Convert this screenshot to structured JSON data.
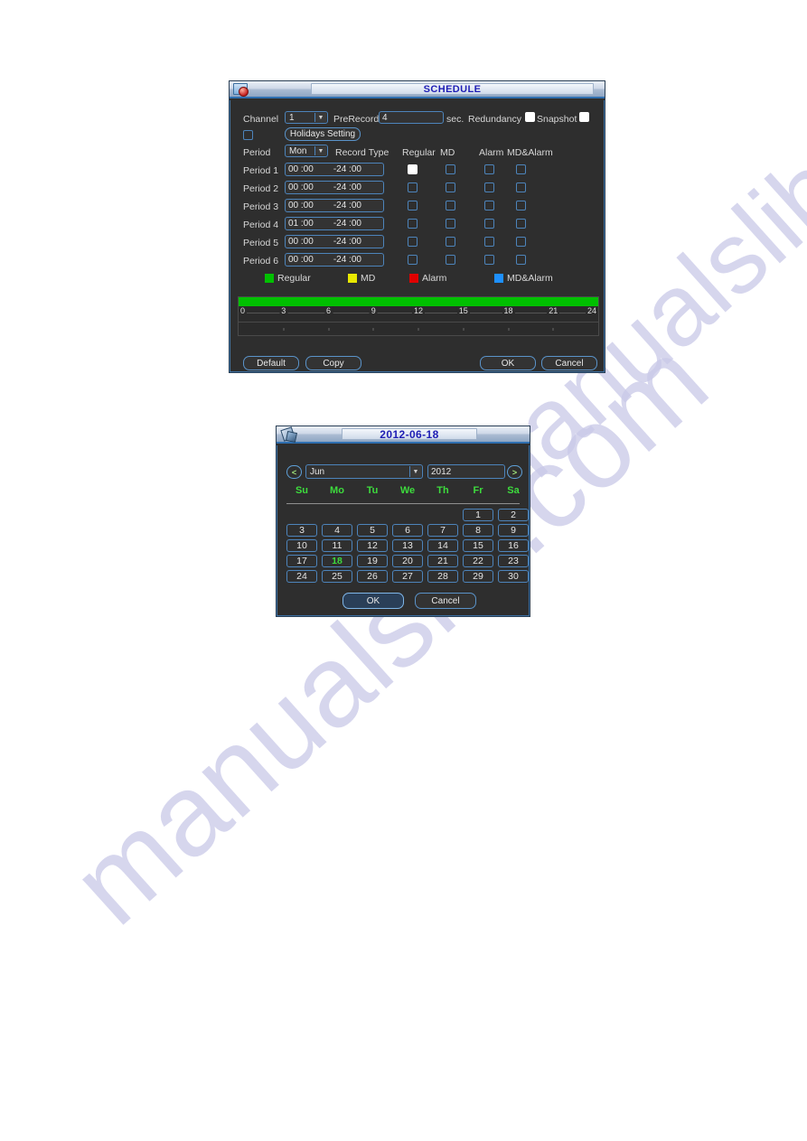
{
  "page": {
    "background": "#ffffff",
    "watermark_text": "manualslib.com",
    "watermark_color": "#c9c9e8"
  },
  "schedule_dialog": {
    "title": "SCHEDULE",
    "title_icon": "folder-clock-icon",
    "channel_label": "Channel",
    "channel_value": "1",
    "prerecord_label": "PreRecord",
    "prerecord_value": "4",
    "sec_label": "sec.",
    "redundancy_label": "Redundancy",
    "redundancy_checked": true,
    "snapshot_label": "Snapshot",
    "snapshot_checked": true,
    "holiday_checkbox_checked": false,
    "holidays_setting_label": "Holidays Setting",
    "period_label": "Period",
    "weekday_value": "Mon",
    "record_type_label": "Record Type",
    "record_type_columns": [
      "Regular",
      "MD",
      "Alarm",
      "MD&Alarm"
    ],
    "periods": [
      {
        "label": "Period 1",
        "start": "00 :00",
        "end": "-24 :00",
        "regular": true,
        "md": false,
        "alarm": false,
        "md_alarm": false
      },
      {
        "label": "Period 2",
        "start": "00 :00",
        "end": "-24 :00",
        "regular": false,
        "md": false,
        "alarm": false,
        "md_alarm": false
      },
      {
        "label": "Period 3",
        "start": "00 :00",
        "end": "-24 :00",
        "regular": false,
        "md": false,
        "alarm": false,
        "md_alarm": false
      },
      {
        "label": "Period 4",
        "start": "01 :00",
        "end": "-24 :00",
        "regular": false,
        "md": false,
        "alarm": false,
        "md_alarm": false
      },
      {
        "label": "Period 5",
        "start": "00 :00",
        "end": "-24 :00",
        "regular": false,
        "md": false,
        "alarm": false,
        "md_alarm": false
      },
      {
        "label": "Period 6",
        "start": "00 :00",
        "end": "-24 :00",
        "regular": false,
        "md": false,
        "alarm": false,
        "md_alarm": false
      }
    ],
    "legend": [
      {
        "label": "Regular",
        "color": "#00c000"
      },
      {
        "label": "MD",
        "color": "#e8e800"
      },
      {
        "label": "Alarm",
        "color": "#e00000"
      },
      {
        "label": "MD&Alarm",
        "color": "#1e90ff"
      }
    ],
    "timeline": {
      "fill_color": "#00c000",
      "fill_from_hour": 0,
      "fill_to_hour": 24,
      "hour_ticks": [
        "0",
        "3",
        "6",
        "9",
        "12",
        "15",
        "18",
        "21",
        "24"
      ]
    },
    "buttons": {
      "default_label": "Default",
      "copy_label": "Copy",
      "ok_label": "OK",
      "cancel_label": "Cancel"
    }
  },
  "calendar_dialog": {
    "title": "2012-06-18",
    "title_icon": "calendar-icon",
    "prev_label": "<",
    "next_label": ">",
    "month_value": "Jun",
    "year_value": "2012",
    "day_headers": [
      "Su",
      "Mo",
      "Tu",
      "We",
      "Th",
      "Fr",
      "Sa"
    ],
    "weeks": [
      [
        "",
        "",
        "",
        "",
        "",
        "1",
        "2"
      ],
      [
        "3",
        "4",
        "5",
        "6",
        "7",
        "8",
        "9"
      ],
      [
        "10",
        "11",
        "12",
        "13",
        "14",
        "15",
        "16"
      ],
      [
        "17",
        "18",
        "19",
        "20",
        "21",
        "22",
        "23"
      ],
      [
        "24",
        "25",
        "26",
        "27",
        "28",
        "29",
        "30"
      ]
    ],
    "selected_day": "18",
    "selected_color": "#3ddc3d",
    "ok_label": "OK",
    "cancel_label": "Cancel"
  }
}
